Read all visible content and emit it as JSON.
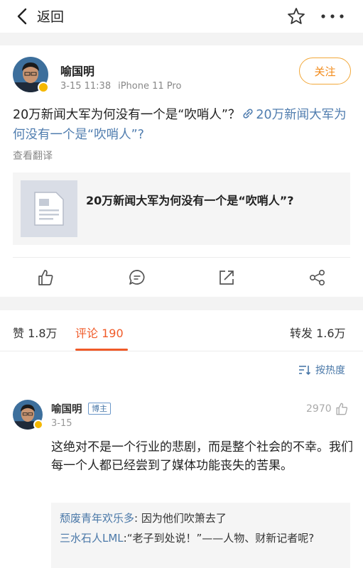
{
  "nav": {
    "back_label": "返回"
  },
  "post": {
    "author": "喻国明",
    "date": "3-15 11:38",
    "device": "iPhone 11 Pro",
    "follow_label": "关注",
    "text": "20万新闻大军为何没有一个是“吹哨人”？",
    "link_text": "20万新闻大军为何没有一个是“吹哨人”?",
    "translate_label": "查看翻译",
    "card_title": "20万新闻大军为何没有一个是“吹哨人”?"
  },
  "tabs": {
    "likes": "赞 1.8万",
    "comments": "评论 190",
    "reposts": "转发 1.6万"
  },
  "sort_label": "按热度",
  "comment": {
    "author": "喻国明",
    "badge": "博主",
    "date": "3-15",
    "likes": "2970",
    "text": "这绝对不是一个行业的悲剧，而是整个社会的不幸。我们每一个人都已经尝到了媒体功能丧失的苦果。",
    "replies": [
      {
        "name": "颓废青年欢乐多",
        "text": ": 因为他们吹箫去了"
      },
      {
        "name": "三水石人LML",
        "text": ":“老子到处说！”——人物、财新记者呢?"
      }
    ]
  },
  "colors": {
    "accent": "#f05a28",
    "link": "#507daf",
    "follow": "#f28a18",
    "verified": "#f5b800"
  }
}
